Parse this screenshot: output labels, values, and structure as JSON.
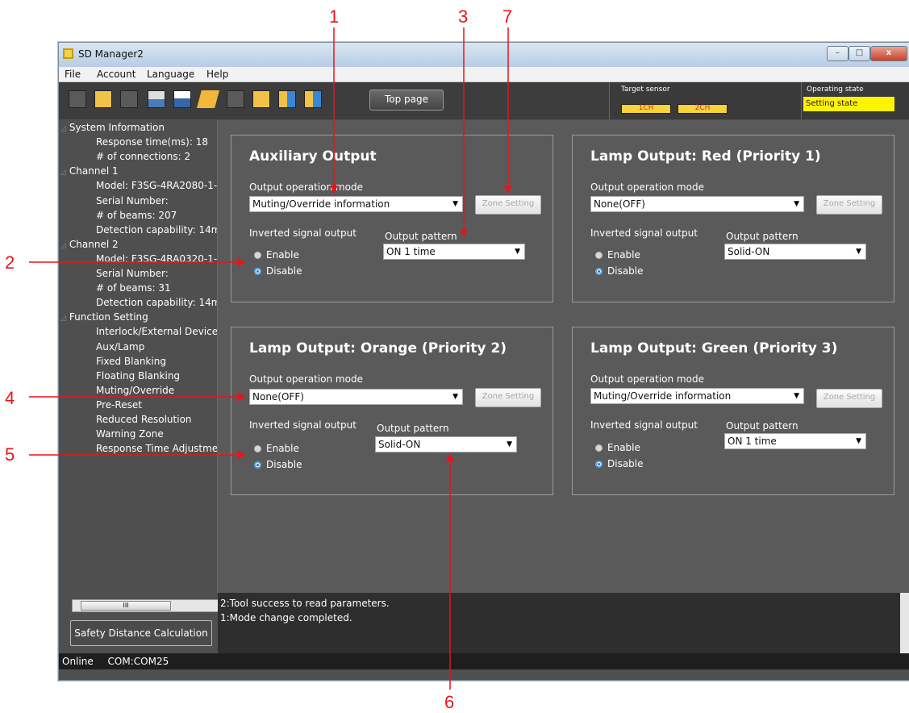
{
  "window": {
    "title": "SD Manager2",
    "min": "–",
    "max": "□",
    "close": "x"
  },
  "menu": [
    "File",
    "Account",
    "Language",
    "Help"
  ],
  "toolbar": {
    "top_page": "Top page",
    "target_sensor_label": "Target sensor",
    "ch1": "1CH",
    "ch2": "2CH",
    "operating_state_label": "Operating state",
    "operating_state_value": "Setting state"
  },
  "tree": [
    {
      "text": "System Information",
      "level": 0
    },
    {
      "text": "Response time(ms): 18",
      "level": 1
    },
    {
      "text": "# of connections: 2",
      "level": 1
    },
    {
      "text": "Channel 1",
      "level": 0
    },
    {
      "text": "Model: F3SG-4RA2080-1-",
      "level": 1
    },
    {
      "text": "Serial Number:",
      "level": 1
    },
    {
      "text": "# of beams: 207",
      "level": 1
    },
    {
      "text": "Detection capability: 14m",
      "level": 1
    },
    {
      "text": "Channel 2",
      "level": 0
    },
    {
      "text": "Model: F3SG-4RA0320-1-",
      "level": 1
    },
    {
      "text": "Serial Number:",
      "level": 1
    },
    {
      "text": "# of beams: 31",
      "level": 1
    },
    {
      "text": "Detection capability: 14m",
      "level": 1
    },
    {
      "text": "Function Setting",
      "level": 0
    },
    {
      "text": "Interlock/External Device",
      "level": 1
    },
    {
      "text": "Aux/Lamp",
      "level": 1
    },
    {
      "text": "Fixed Blanking",
      "level": 1
    },
    {
      "text": "Floating Blanking",
      "level": 1
    },
    {
      "text": "Muting/Override",
      "level": 1
    },
    {
      "text": "Pre-Reset",
      "level": 1
    },
    {
      "text": "Reduced Resolution",
      "level": 1
    },
    {
      "text": "Warning Zone",
      "level": 1
    },
    {
      "text": "Response Time Adjustme",
      "level": 1
    }
  ],
  "scroll_thumb": "III",
  "safety_button": "Safety Distance Calculation",
  "status": {
    "mode": "Online",
    "port": "COM:COM25"
  },
  "log": [
    "2:Tool success to read parameters.",
    "1:Mode change completed."
  ],
  "common": {
    "mode_label": "Output operation mode",
    "inverted_label": "Inverted signal output",
    "pattern_label": "Output pattern",
    "zone_button": "Zone Setting",
    "enable": "Enable",
    "disable": "Disable"
  },
  "panels": [
    {
      "title": "Auxiliary Output",
      "mode": "Muting/Override information",
      "pattern": "ON 1 time",
      "inverted": "Disable"
    },
    {
      "title": "Lamp Output: Red (Priority 1)",
      "mode": "None(OFF)",
      "pattern": "Solid-ON",
      "inverted": "Disable"
    },
    {
      "title": "Lamp Output: Orange (Priority 2)",
      "mode": "None(OFF)",
      "pattern": "Solid-ON",
      "inverted": "Disable"
    },
    {
      "title": "Lamp Output: Green (Priority 3)",
      "mode": "Muting/Override information",
      "pattern": "ON 1 time",
      "inverted": "Disable"
    }
  ],
  "callouts": [
    "1",
    "2",
    "3",
    "4",
    "5",
    "6",
    "7"
  ],
  "colors": {
    "callout": "#e8141a",
    "state_bg": "#fff400",
    "background": "#4f4f4f"
  }
}
